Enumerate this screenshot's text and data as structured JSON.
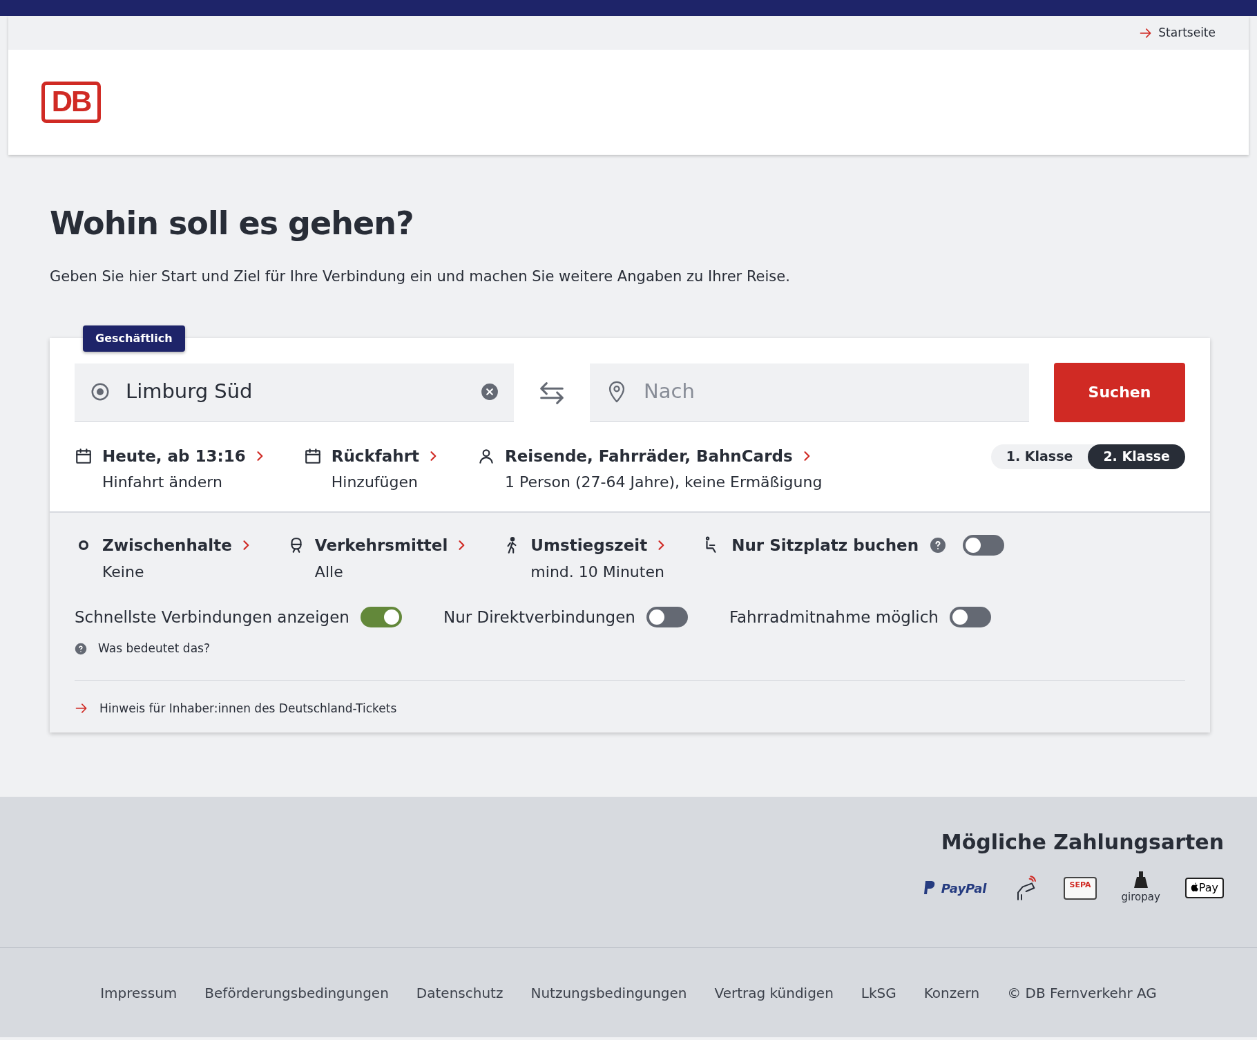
{
  "header": {
    "top_link": "Startseite",
    "logo": "DB"
  },
  "heading": "Wohin soll es gehen?",
  "intro": "Geben Sie hier Start und Ziel für Ihre Verbindung ein und machen Sie weitere Angaben zu Ihrer Reise.",
  "search": {
    "badge": "Geschäftlich",
    "from": {
      "value": "Limburg Süd"
    },
    "to": {
      "placeholder": "Nach"
    },
    "submit": "Suchen",
    "options": [
      {
        "kind": "calendar",
        "title": "Heute, ab 13:16",
        "subtitle": "Hinfahrt ändern"
      },
      {
        "kind": "calendar",
        "title": "Rückfahrt",
        "subtitle": "Hinzufügen"
      },
      {
        "kind": "person",
        "title": "Reisende, Fahrräder, BahnCards",
        "subtitle": "1 Person (27-64 Jahre), keine Ermäßigung"
      }
    ],
    "classes": [
      {
        "label": "1. Klasse",
        "selected": false
      },
      {
        "label": "2. Klasse",
        "selected": true
      }
    ]
  },
  "extras": {
    "options": [
      {
        "kind": "stop",
        "title": "Zwischenhalte",
        "subtitle": "Keine"
      },
      {
        "kind": "train",
        "title": "Verkehrsmittel",
        "subtitle": "Alle"
      },
      {
        "kind": "walk",
        "title": "Umstiegszeit",
        "subtitle": "mind. 10 Minuten"
      }
    ],
    "seat": {
      "label": "Nur Sitzplatz buchen",
      "on": false
    },
    "toggles": [
      {
        "label": "Schnellste Verbindungen anzeigen",
        "on": true
      },
      {
        "label": "Nur Direktverbindungen",
        "on": false
      },
      {
        "label": "Fahrradmitnahme möglich",
        "on": false
      }
    ],
    "help": "Was bedeutet das?",
    "hint": "Hinweis für Inhaber:innen des Deutschland-Tickets"
  },
  "footer": {
    "payment_title": "Mögliche Zahlungsarten",
    "payment_methods": [
      {
        "kind": "paypal",
        "label": "PayPal"
      },
      {
        "kind": "contactless"
      },
      {
        "kind": "sepa",
        "label": "SEPA"
      },
      {
        "kind": "giropay",
        "label": "giropay"
      },
      {
        "kind": "applepay",
        "label": "Pay"
      }
    ],
    "links": [
      "Impressum",
      "Beförderungsbedingungen",
      "Datenschutz",
      "Nutzungsbedingungen",
      "Vertrag kündigen",
      "LkSG",
      "Konzern",
      "© DB Fernverkehr AG"
    ]
  }
}
